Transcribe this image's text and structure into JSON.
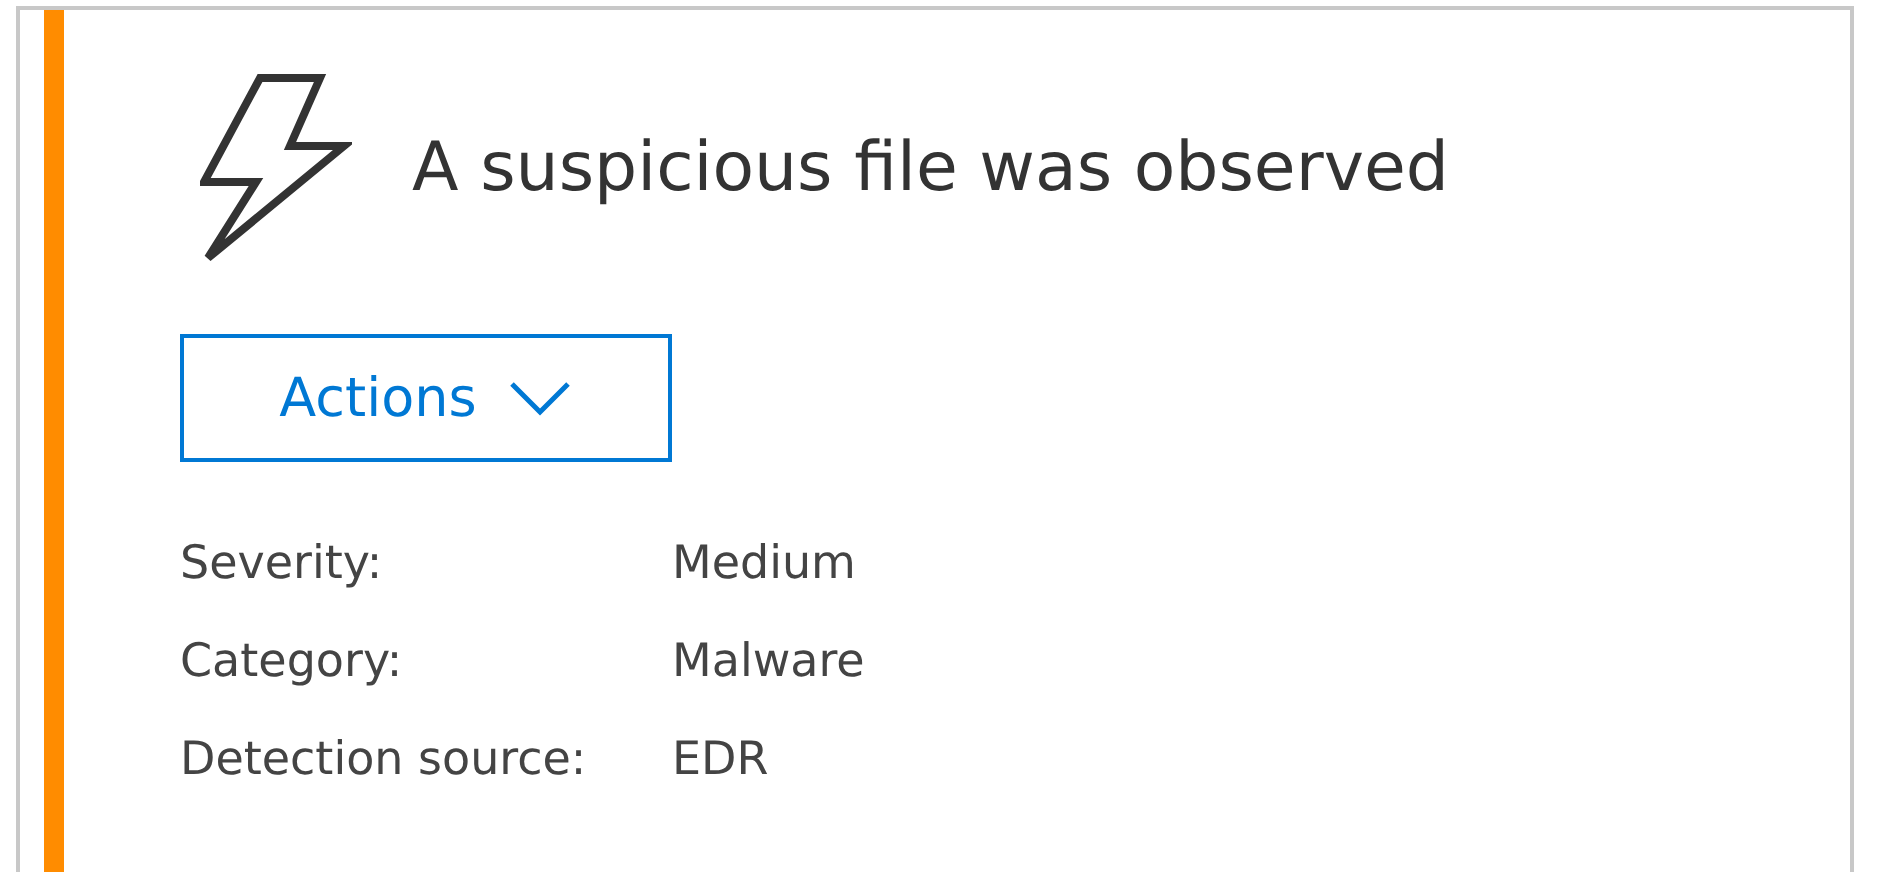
{
  "alert": {
    "title": "A suspicious file was observed",
    "actions_button": {
      "label": "Actions"
    },
    "details": [
      {
        "label": "Severity:",
        "value": "Medium"
      },
      {
        "label": "Category:",
        "value": "Malware"
      },
      {
        "label": "Detection source:",
        "value": "EDR"
      }
    ]
  }
}
